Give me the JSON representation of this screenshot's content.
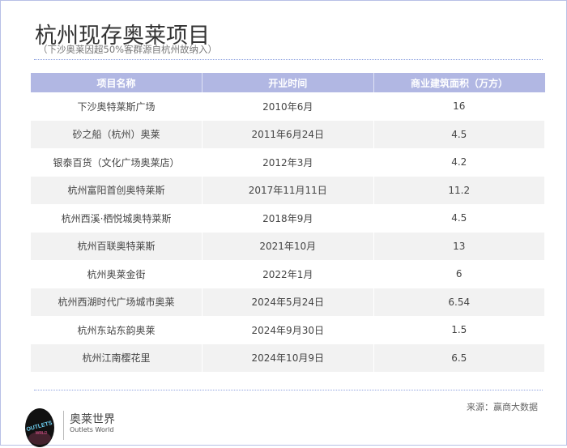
{
  "title": "杭州现存奥莱项目",
  "subtitle": "（下沙奥莱因超50%客群源自杭州故纳入）",
  "table": {
    "headers": [
      "项目名称",
      "开业时间",
      "商业建筑面积（万方）"
    ],
    "rows": [
      [
        "下沙奥特莱斯广场",
        "2010年6月",
        "16"
      ],
      [
        "砂之船（杭州）奥莱",
        "2011年6月24日",
        "4.5"
      ],
      [
        "银泰百货（文化广场奥莱店）",
        "2012年3月",
        "4.2"
      ],
      [
        "杭州富阳首创奥特莱斯",
        "2017年11月11日",
        "11.2"
      ],
      [
        "杭州西溪·栖悦城奥特莱斯",
        "2018年9月",
        "4.5"
      ],
      [
        "杭州百联奥特莱斯",
        "2021年10月",
        "13"
      ],
      [
        "杭州奥莱金街",
        "2022年1月",
        "6"
      ],
      [
        "杭州西湖时代广场城市奥莱",
        "2024年5月24日",
        "6.54"
      ],
      [
        "杭州东站东韵奥莱",
        "2024年9月30日",
        "1.5"
      ],
      [
        "杭州江南樱花里",
        "2024年10月9日",
        "6.5"
      ]
    ]
  },
  "footer": {
    "brand": "奥莱世界",
    "brand_en": "Outlets World",
    "logo_text": "OUTLETS",
    "source": "来源：赢商大数据"
  }
}
